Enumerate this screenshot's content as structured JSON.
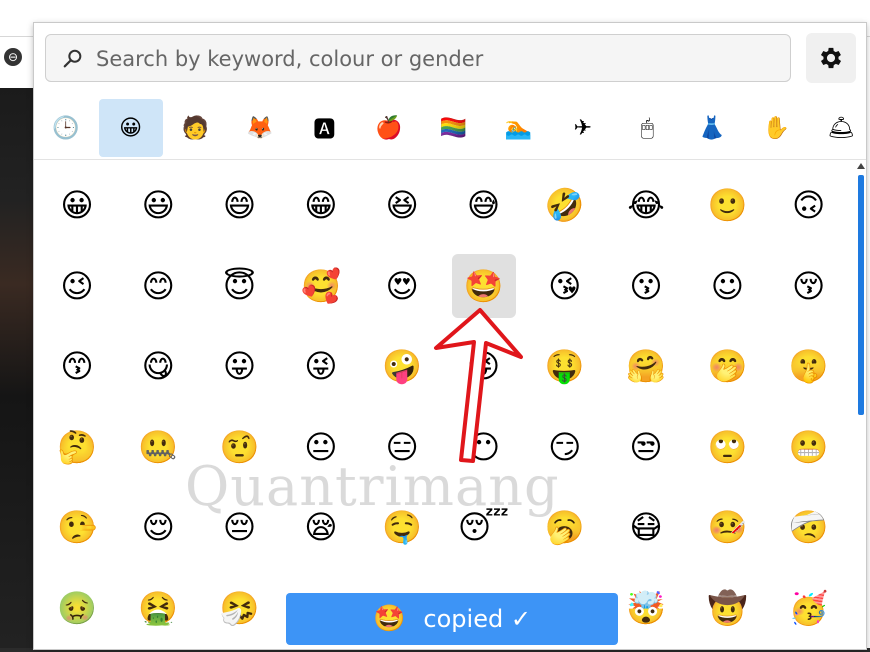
{
  "search": {
    "placeholder": "Search by keyword, colour or gender"
  },
  "settings": {
    "icon": "gear-icon"
  },
  "categories": [
    {
      "name": "recent",
      "glyph": "🕒"
    },
    {
      "name": "smileys",
      "glyph": "😀"
    },
    {
      "name": "people",
      "glyph": "🧑"
    },
    {
      "name": "animals",
      "glyph": "🦊"
    },
    {
      "name": "symbols",
      "glyph": "🅰"
    },
    {
      "name": "food",
      "glyph": "🍎"
    },
    {
      "name": "flags",
      "glyph": "🏳️‍🌈"
    },
    {
      "name": "activities",
      "glyph": "🏊"
    },
    {
      "name": "travel",
      "glyph": "✈"
    },
    {
      "name": "objects",
      "glyph": "🖱"
    },
    {
      "name": "clothing",
      "glyph": "👗"
    },
    {
      "name": "hands",
      "glyph": "✋"
    },
    {
      "name": "alert",
      "glyph": "🛎"
    }
  ],
  "active_category": 1,
  "emoji_rows": [
    [
      "😀",
      "😃",
      "😄",
      "😁",
      "😆",
      "😅",
      "🤣",
      "😂",
      "🙂",
      "🙃"
    ],
    [
      "😉",
      "😊",
      "😇",
      "🥰",
      "😍",
      "🤩",
      "😘",
      "😗",
      "☺",
      "😚"
    ],
    [
      "😙",
      "😋",
      "😛",
      "😜",
      "🤪",
      "😝",
      "🤑",
      "🤗",
      "🤭",
      "🤫"
    ],
    [
      "🤔",
      "🤐",
      "🤨",
      "😐",
      "😑",
      "😶",
      "😏",
      "😒",
      "🙄",
      "😬"
    ],
    [
      "🤥",
      "😌",
      "😔",
      "😪",
      "🤤",
      "😴",
      "🥱",
      "😷",
      "🤒",
      "🤕"
    ],
    [
      "🤢",
      "🤮",
      "🤧",
      "",
      "",
      "",
      "",
      "🤯",
      "🤠",
      "🥳"
    ]
  ],
  "selected_emoji": "🤩",
  "toast": {
    "emoji": "🤩",
    "text": "copied ✓"
  },
  "watermark": "Quantrimang",
  "colors": {
    "accent": "#3d94f6",
    "active_tab": "#cfe5f8",
    "scrollbar": "#1e7ae0",
    "arrow": "#e0161b"
  }
}
